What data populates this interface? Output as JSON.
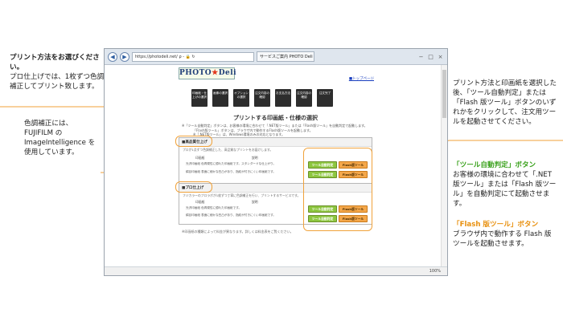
{
  "notes": {
    "print_method_title": "プリント方法をお選びください。",
    "print_method_body": "プロ仕上げでは、1枚ずつ色調補正してプリント致します。",
    "color_correction": "色調補正には、FUJIFILM の ImageIntelligence を使用しています。",
    "right_intro": "プリント方法と印画紙を選択した後、「ツール自動判定」または「Flash 版ツール」ボタンのいずれかをクリックして、注文用ツールを起動させてください。",
    "auto_title": "「ツール自動判定」ボタン",
    "auto_body": "お客様の環境に合わせて「.NET 版ツール」または「Flash 版ツール」を自動判定にて起動させます。",
    "flash_title": "「Flash 版ツール」ボタン",
    "flash_body": "ブラウザ内で動作する Flash 版ツールを起動させます。"
  },
  "browser": {
    "back": "◀",
    "forward": "▶",
    "address": "https://photodeli.net/ ρ - 🔒 ↻",
    "tab": "サービスご案内 PHOTO Deli ×",
    "minimize": "−",
    "maximize": "□",
    "close": "×",
    "zoom": "100%"
  },
  "page": {
    "logo_text": "PHOTO",
    "logo_star": "★",
    "logo_suffix": "Deli",
    "top_link": "■トップページ",
    "steps": [
      "印画紙・仕上げの選択",
      "画像の選択",
      "オプションの選択",
      "注文内容の確認",
      "お支払方法",
      "注文内容の確認",
      "注文完了"
    ],
    "heading": "プリントする印画紙・仕様の選択",
    "desc1": "※「ツール自動判定」ボタンは、お客様の環境に合わせて「.NET版ツール」または「Flash版ツール」を自動判定で起動します。",
    "desc2": "「Flash版ツール」ボタンは、ブラウザ内で動作するFlash版ツールを起動します。",
    "desc3": "※「.NET版ツール」は、Windows環境のみの対応となります。",
    "panel1": {
      "title": "■高品質仕上げ",
      "sub": "プロが1点ずつ色調補正した、高品質なプリントをお届けします。",
      "col_type": "印画紙",
      "col_desc": "説明",
      "rows": [
        "光沢印画紙  色再現性に優れた印画紙です。スタンダードな仕上がり。",
        "絹目印画紙  表面に細かな凹凸があり、指紋が付きにくい印画紙です。"
      ]
    },
    "panel2": {
      "title": "■プロ仕上げ",
      "sub": "フジカラーのプロラボが1枚ずつ丁寧に色調補正を行い、プリントするサービスです。",
      "col_type": "印画紙",
      "col_desc": "説明",
      "rows": [
        "光沢印画紙  色再現性に優れた印画紙です。",
        "絹目印画紙  表面に細かな凹凸があり、指紋が付きにくい印画紙です。"
      ]
    },
    "btn_auto": "ツール自動判定",
    "btn_flash": "Flash版ツール",
    "bottom_note": "※印画紙の種類によって料金が異なります。詳しくは料金表をご覧ください。"
  }
}
